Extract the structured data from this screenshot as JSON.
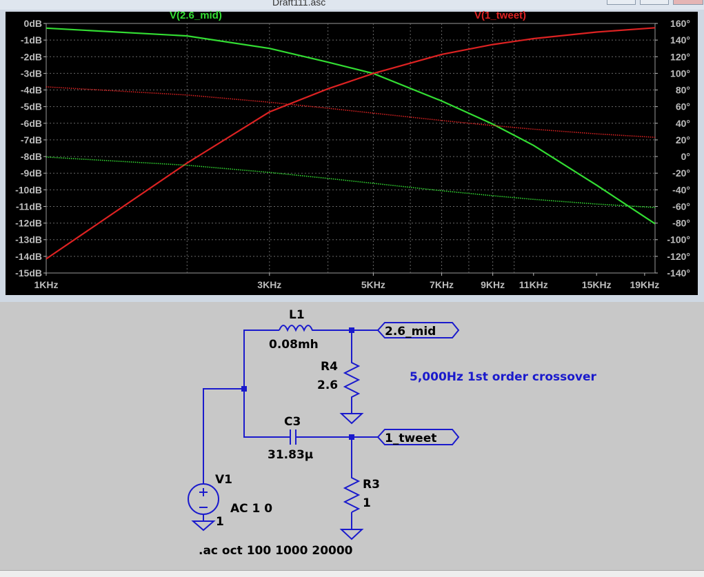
{
  "window": {
    "title": "Draft111.asc"
  },
  "plot": {
    "legend": [
      {
        "label": "V(2.6_mid)",
        "color": "#33dd33"
      },
      {
        "label": "V(1_tweet)",
        "color": "#dd2222"
      }
    ],
    "y_left_ticks": [
      "0dB",
      "-1dB",
      "-2dB",
      "-3dB",
      "-4dB",
      "-5dB",
      "-6dB",
      "-7dB",
      "-8dB",
      "-9dB",
      "-10dB",
      "-11dB",
      "-12dB",
      "-13dB",
      "-14dB",
      "-15dB"
    ],
    "y_right_ticks": [
      "160°",
      "140°",
      "120°",
      "100°",
      "80°",
      "60°",
      "40°",
      "20°",
      "0°",
      "-20°",
      "-40°",
      "-60°",
      "-80°",
      "-100°",
      "-120°",
      "-140°"
    ],
    "x_ticks": [
      "1KHz",
      "3KHz",
      "5KHz",
      "7KHz",
      "9KHz",
      "11KHz",
      "15KHz",
      "19KHz"
    ]
  },
  "chart_data": {
    "type": "line",
    "x_scale": "log",
    "xlim": [
      1000,
      20000
    ],
    "ylim_left_db": [
      -15,
      0
    ],
    "ylim_right_deg": [
      -140,
      160
    ],
    "grid": true,
    "series": [
      {
        "name": "V(2.6_mid)",
        "kind": "magnitude",
        "color": "#33dd33",
        "x": [
          1000,
          2000,
          3000,
          4000,
          5000,
          7000,
          9000,
          11000,
          15000,
          20000
        ],
        "y": [
          -0.28,
          -0.75,
          -1.5,
          -2.33,
          -3.01,
          -4.66,
          -6.05,
          -7.33,
          -9.72,
          -12.04
        ]
      },
      {
        "name": "V(1_tweet)",
        "kind": "magnitude",
        "color": "#dd2222",
        "x": [
          1000,
          2000,
          3000,
          4000,
          5000,
          7000,
          9000,
          11000,
          15000,
          20000
        ],
        "y": [
          -14.15,
          -8.39,
          -5.32,
          -3.93,
          -3.01,
          -1.86,
          -1.27,
          -0.91,
          -0.52,
          -0.26
        ]
      },
      {
        "name": "V(2.6_mid)",
        "kind": "phase",
        "color": "#33dd33",
        "x": [
          1000,
          2000,
          3000,
          4000,
          5000,
          7000,
          9000,
          11000,
          15000,
          20000
        ],
        "y": [
          -11.3,
          -21.8,
          -31.0,
          -38.7,
          -45.0,
          -54.5,
          -60.9,
          -65.6,
          -71.6,
          -76.0
        ]
      },
      {
        "name": "V(1_tweet)",
        "kind": "phase",
        "color": "#dd2222",
        "x": [
          1000,
          2000,
          3000,
          4000,
          5000,
          7000,
          9000,
          11000,
          15000,
          20000
        ],
        "y": [
          78.7,
          68.2,
          59.0,
          51.3,
          45.0,
          35.5,
          29.1,
          24.4,
          18.4,
          14.0
        ]
      }
    ]
  },
  "schematic": {
    "L1": {
      "name": "L1",
      "value": "0.08mh"
    },
    "R4": {
      "name": "R4",
      "value": "2.6"
    },
    "C3": {
      "name": "C3",
      "value": "31.83µ"
    },
    "R3": {
      "name": "R3",
      "value": "1"
    },
    "V1": {
      "name": "V1",
      "value": "AC 1 0",
      "series_r": "1"
    },
    "mid_net": "2.6_mid",
    "tweet_net": "1_tweet",
    "comment": "5,000Hz 1st order crossover",
    "directive": ".ac oct 100 1000 20000"
  }
}
